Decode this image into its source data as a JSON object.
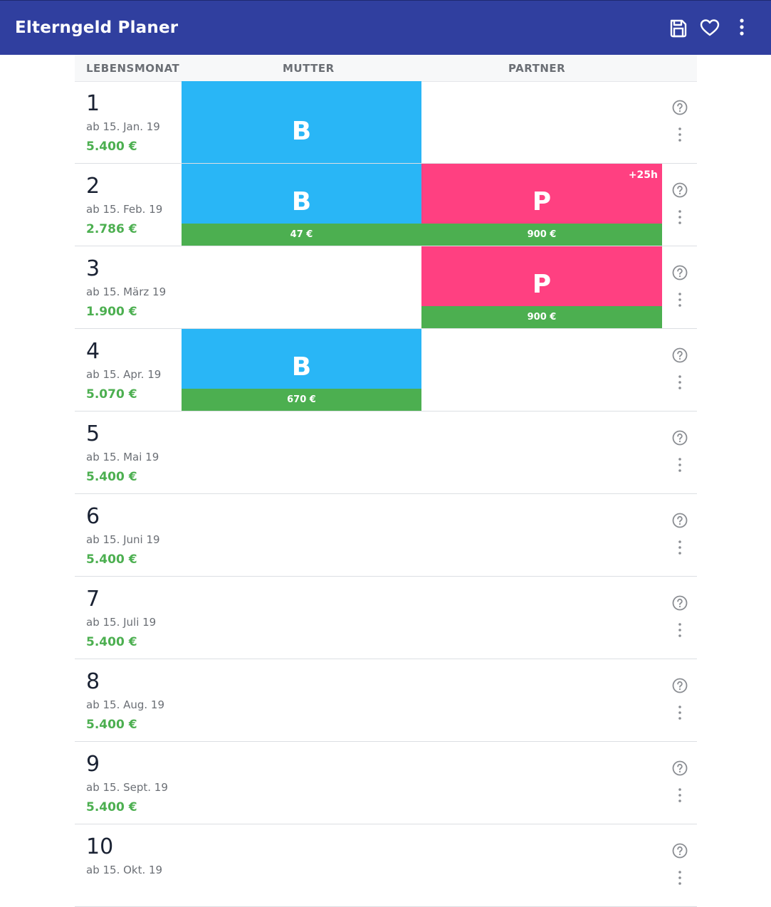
{
  "app": {
    "title": "Elterngeld Planer"
  },
  "toolbar": {
    "save_icon": "save-icon",
    "favorite_icon": "heart-icon",
    "menu_icon": "more-vert-icon"
  },
  "table": {
    "headers": {
      "month": "LEBENSMONAT",
      "mother": "MUTTER",
      "partner": "PARTNER"
    },
    "rows": [
      {
        "num": "1",
        "date": "ab 15. Jan. 19",
        "amount": "5.400 €",
        "mother": {
          "type": "basis",
          "letter": "B",
          "amount": ""
        },
        "partner": null
      },
      {
        "num": "2",
        "date": "ab 15. Feb. 19",
        "amount": "2.786 €",
        "mother": {
          "type": "basis",
          "letter": "B",
          "amount": "47 €"
        },
        "partner": {
          "type": "plus",
          "letter": "P",
          "amount": "900 €",
          "hours": "+25h"
        }
      },
      {
        "num": "3",
        "date": "ab 15. März 19",
        "amount": "1.900 €",
        "mother": null,
        "partner": {
          "type": "plus",
          "letter": "P",
          "amount": "900 €"
        }
      },
      {
        "num": "4",
        "date": "ab 15. Apr. 19",
        "amount": "5.070 €",
        "mother": {
          "type": "basis",
          "letter": "B",
          "amount": "670 €"
        },
        "partner": null
      },
      {
        "num": "5",
        "date": "ab 15. Mai 19",
        "amount": "5.400 €",
        "mother": null,
        "partner": null
      },
      {
        "num": "6",
        "date": "ab 15. Juni 19",
        "amount": "5.400 €",
        "mother": null,
        "partner": null
      },
      {
        "num": "7",
        "date": "ab 15. Juli 19",
        "amount": "5.400 €",
        "mother": null,
        "partner": null
      },
      {
        "num": "8",
        "date": "ab 15. Aug. 19",
        "amount": "5.400 €",
        "mother": null,
        "partner": null
      },
      {
        "num": "9",
        "date": "ab 15. Sept. 19",
        "amount": "5.400 €",
        "mother": null,
        "partner": null
      },
      {
        "num": "10",
        "date": "ab 15. Okt. 19",
        "amount": "",
        "mother": null,
        "partner": null
      }
    ]
  },
  "colors": {
    "appbar": "#303f9f",
    "basis": "#29b6f6",
    "plus": "#ff4081",
    "amount_green": "#4caf50"
  }
}
